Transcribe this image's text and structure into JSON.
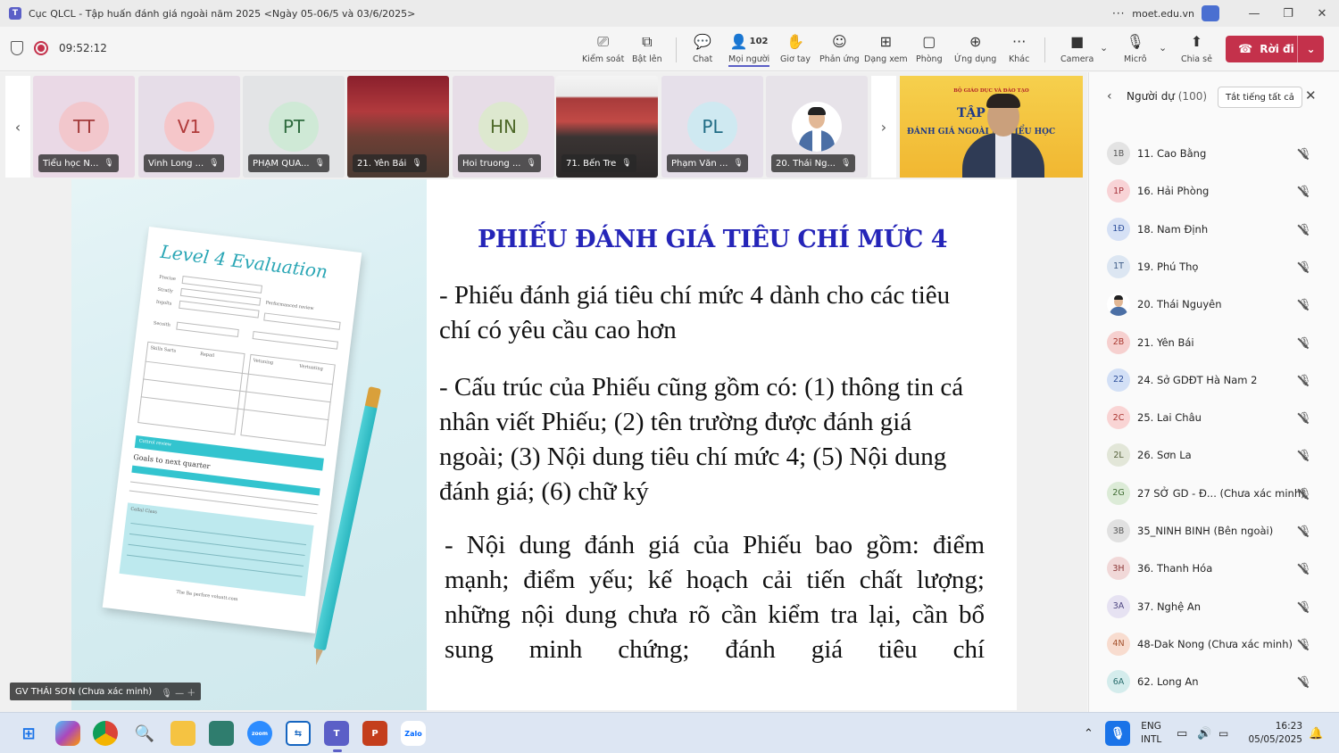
{
  "window": {
    "title": "Cục QLCL - Tập huấn đánh giá ngoài năm 2025 <Ngày 05-06/5 và 03/6/2025>",
    "org": "moet.edu.vn",
    "more": "···",
    "minimize": "—",
    "restore": "❐",
    "close": "✕"
  },
  "toolbar": {
    "timer": "09:52:12",
    "people_count": "102",
    "buttons": [
      {
        "label": "Kiểm soát",
        "icon": "control-icon"
      },
      {
        "label": "Bật lên",
        "icon": "popout-icon"
      },
      {
        "label": "Chat",
        "icon": "chat-icon"
      },
      {
        "label": "Mọi người",
        "icon": "people-icon"
      },
      {
        "label": "Giơ tay",
        "icon": "raise-hand-icon"
      },
      {
        "label": "Phản ứng",
        "icon": "reaction-icon"
      },
      {
        "label": "Dạng xem",
        "icon": "view-icon"
      },
      {
        "label": "Phòng",
        "icon": "rooms-icon"
      },
      {
        "label": "Ứng dụng",
        "icon": "apps-icon"
      },
      {
        "label": "Khác",
        "icon": "more-icon"
      },
      {
        "label": "Camera",
        "icon": "camera-icon"
      },
      {
        "label": "Micrô",
        "icon": "mic-icon"
      },
      {
        "label": "Chia sẻ",
        "icon": "share-icon"
      }
    ],
    "leave_label": "Rời đi"
  },
  "tiles": [
    {
      "initials": "TT",
      "name": "Tiểu học N...",
      "bg": "#ead9e6",
      "av_bg": "#f2c7cc",
      "av_color": "#a33a3a"
    },
    {
      "initials": "V1",
      "name": "Vinh Long ...",
      "bg": "#e6dde8",
      "av_bg": "#f5c6c9",
      "av_color": "#b03a3a"
    },
    {
      "initials": "PT",
      "name": "PHẠM QUA...",
      "bg": "#e3e4e6",
      "av_bg": "#cfe9d6",
      "av_color": "#2e6b3e"
    },
    {
      "initials": "",
      "name": "21. Yên Bái",
      "bg": "",
      "av_bg": "",
      "av_color": ""
    },
    {
      "initials": "HN",
      "name": "Hoi truong ...",
      "bg": "#e7dde7",
      "av_bg": "#dde8cf",
      "av_color": "#4f6a2a"
    },
    {
      "initials": "",
      "name": "71. Bến Tre",
      "bg": "",
      "av_bg": "",
      "av_color": ""
    },
    {
      "initials": "PL",
      "name": "Phạm Văn ...",
      "bg": "#e6e0ea",
      "av_bg": "#cfe9f1",
      "av_color": "#1f6b84"
    },
    {
      "initials": "",
      "name": "20. Thái Ng...",
      "bg": "#e7e3e9",
      "av_bg": "",
      "av_color": ""
    }
  ],
  "presenter": {
    "banner_top": "BỘ GIÁO DỤC VÀ ĐÀO TẠO",
    "banner_big": "TẬP",
    "banner_sub": "ĐÁNH GIÁ NGOÀI              NG TIỂU HỌC"
  },
  "slide": {
    "image": {
      "title": "Level 4 Evaluation",
      "texts": [
        "Precise",
        "Stratly",
        "Ingolts",
        "Secoith",
        "Performanced review",
        "Skills Sarts",
        "Repail",
        "Vetuning",
        "Vertuating",
        "Cottrol review",
        "Goals to next quarter",
        "Cellal Class",
        "The Ba perfore voluatt.com"
      ]
    },
    "heading": "PHIẾU ĐÁNH GIÁ TIÊU CHÍ MỨC 4",
    "paragraphs": [
      "- Phiếu đánh giá tiêu chí mức 4 dành cho các tiêu chí có yêu cầu cao hơn",
      "- Cấu trúc của Phiếu cũng gồm có: (1) thông tin cá nhân viết Phiếu; (2) tên trường được đánh giá ngoài; (3) Nội dung tiêu chí mức 4; (5) Nội dung đánh giá; (6) chữ ký",
      "- Nội dung đánh giá của Phiếu bao gồm: điểm mạnh; điểm yếu; kế hoạch cải tiến chất lượng; những nội dung chưa rõ cần kiểm tra lại, cần bổ sung minh chứng; đánh giá tiêu chí"
    ]
  },
  "self_tag": "GV THÁI SƠN (Chưa xác minh)",
  "panel": {
    "title": "Người dự",
    "count": "(100)",
    "mute_all": "Tắt tiếng tất cả",
    "participants": [
      {
        "initials": "1B",
        "name": "11. Cao Bằng",
        "bg": "#e3e3e3",
        "color": "#555"
      },
      {
        "initials": "1P",
        "name": "16. Hải Phòng",
        "bg": "#f8d3d6",
        "color": "#a6323b"
      },
      {
        "initials": "1Đ",
        "name": "18. Nam Định",
        "bg": "#d6e1f5",
        "color": "#2d4f9b"
      },
      {
        "initials": "1T",
        "name": "19. Phú Thọ",
        "bg": "#dce6f2",
        "color": "#3b5a85"
      },
      {
        "initials": "",
        "name": "20. Thái Nguyên",
        "bg": "#ffffff",
        "color": "#333"
      },
      {
        "initials": "2B",
        "name": "21. Yên Bái",
        "bg": "#f6d0cf",
        "color": "#a8372f"
      },
      {
        "initials": "22",
        "name": "24. Sở GDĐT Hà Nam 2",
        "bg": "#d3e0f6",
        "color": "#2b4d99"
      },
      {
        "initials": "2C",
        "name": "25. Lai Châu",
        "bg": "#f9d4d4",
        "color": "#a8322e"
      },
      {
        "initials": "2L",
        "name": "26. Sơn La",
        "bg": "#e2e6d8",
        "color": "#55603a"
      },
      {
        "initials": "2G",
        "name": "27 SỞ GD - Đ... (Chưa xác minh)",
        "bg": "#dcebd7",
        "color": "#3f6c33"
      },
      {
        "initials": "3B",
        "name": "35_NINH BINH (Bên ngoài)",
        "bg": "#e1e1e1",
        "color": "#555"
      },
      {
        "initials": "3H",
        "name": "36. Thanh Hóa",
        "bg": "#f1d8d8",
        "color": "#8b3636"
      },
      {
        "initials": "3A",
        "name": "37. Nghệ An",
        "bg": "#e6e2f2",
        "color": "#4d4680"
      },
      {
        "initials": "4N",
        "name": "48-Dak Nong (Chưa xác minh)",
        "bg": "#f8dccf",
        "color": "#a4502b"
      },
      {
        "initials": "6A",
        "name": "62. Long An",
        "bg": "#d4ecec",
        "color": "#2a6e6e"
      }
    ]
  },
  "taskbar": {
    "lang_top": "ENG",
    "lang_bottom": "INTL",
    "time": "16:23",
    "date": "05/05/2025"
  }
}
